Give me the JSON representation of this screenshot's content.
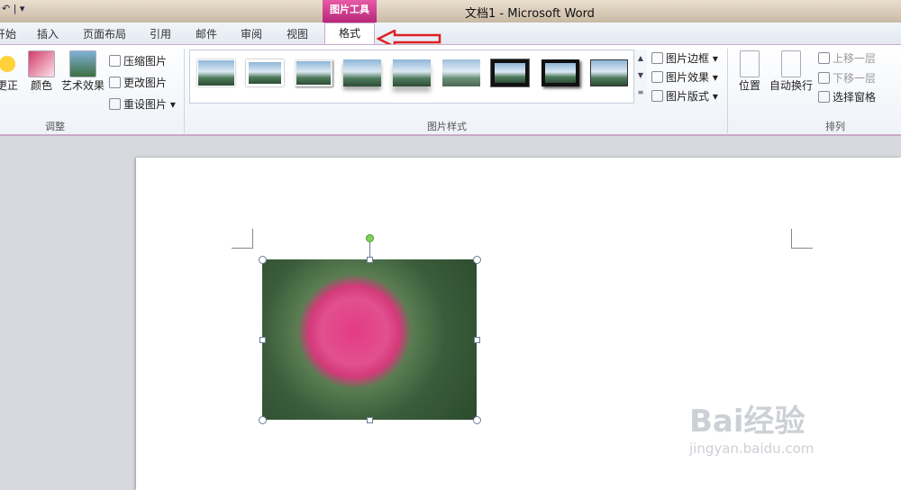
{
  "window": {
    "title": "文档1 - Microsoft Word",
    "context_tab": "图片工具"
  },
  "tabs": [
    {
      "label": "开始",
      "active": false
    },
    {
      "label": "插入",
      "active": false
    },
    {
      "label": "页面布局",
      "active": false
    },
    {
      "label": "引用",
      "active": false
    },
    {
      "label": "邮件",
      "active": false
    },
    {
      "label": "审阅",
      "active": false
    },
    {
      "label": "视图",
      "active": false
    },
    {
      "label": "格式",
      "active": true
    }
  ],
  "ribbon": {
    "adjust_group": {
      "label": "调整",
      "buttons": [
        "更正",
        "颜色",
        "艺术效果"
      ],
      "small_buttons": [
        "压缩图片",
        "更改图片",
        "重设图片"
      ]
    },
    "styles_group": {
      "label": "图片样式",
      "small_buttons": [
        "图片边框",
        "图片效果",
        "图片版式"
      ]
    },
    "arrange_group": {
      "label": "排列",
      "buttons": [
        "位置",
        "自动换行"
      ],
      "small_buttons": [
        "上移一层",
        "下移一层",
        "选择窗格"
      ]
    }
  },
  "watermark": {
    "brand": "Bai经验",
    "url": "jingyan.baidu.com"
  },
  "colors": {
    "accent": "#c9286e",
    "arrow": "#e02020",
    "ribbon_border": "#c9a9c8"
  }
}
